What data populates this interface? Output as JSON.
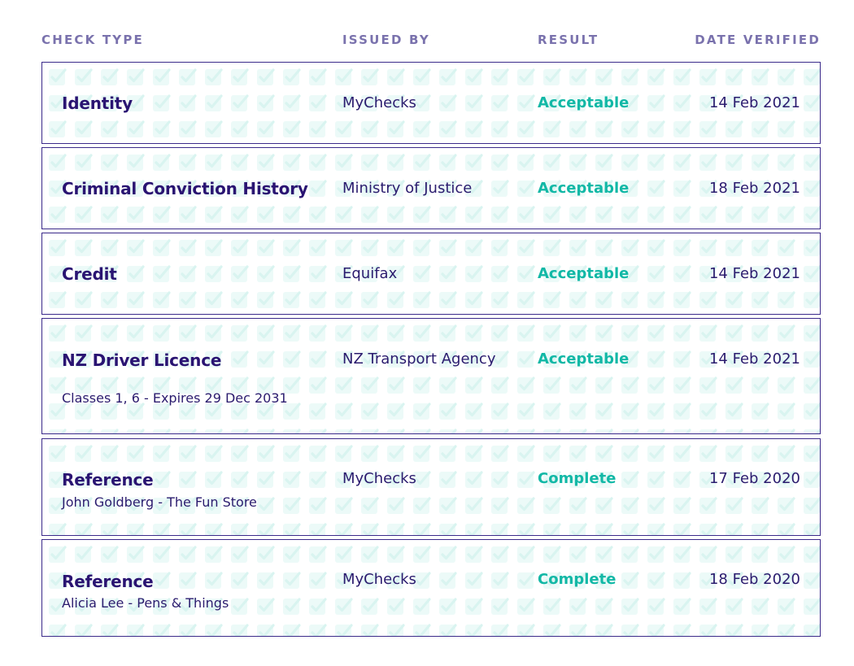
{
  "headers": {
    "check_type": "CHECK TYPE",
    "issued_by": "ISSUED BY",
    "result": "RESULT",
    "date_verified": "DATE VERIFIED"
  },
  "rows": [
    {
      "type": "Identity",
      "subtitle": "",
      "issuer": "MyChecks",
      "result": "Acceptable",
      "date": "14 Feb 2021"
    },
    {
      "type": "Criminal Conviction History",
      "subtitle": "",
      "issuer": "Ministry of Justice",
      "result": "Acceptable",
      "date": "18 Feb 2021"
    },
    {
      "type": "Credit",
      "subtitle": "",
      "issuer": "Equifax",
      "result": "Acceptable",
      "date": "14 Feb 2021"
    },
    {
      "type": "NZ Driver Licence",
      "subtitle": "Classes 1, 6 - Expires 29 Dec 2031",
      "issuer": "NZ Transport Agency",
      "result": "Acceptable",
      "date": "14 Feb 2021"
    },
    {
      "type": "Reference",
      "subtitle": "John Goldberg - The Fun Store",
      "issuer": "MyChecks",
      "result": "Complete",
      "date": "17 Feb 2020"
    },
    {
      "type": "Reference",
      "subtitle": "Alicia Lee - Pens & Things",
      "issuer": "MyChecks",
      "result": "Complete",
      "date": "18 Feb 2020"
    }
  ],
  "colors": {
    "accent_teal": "#12b8a6",
    "border_purple": "#3b2a8a",
    "header_muted": "#7a72ad",
    "text_dark": "#2a1472"
  },
  "icons": [
    "checkbox-check-pattern"
  ]
}
